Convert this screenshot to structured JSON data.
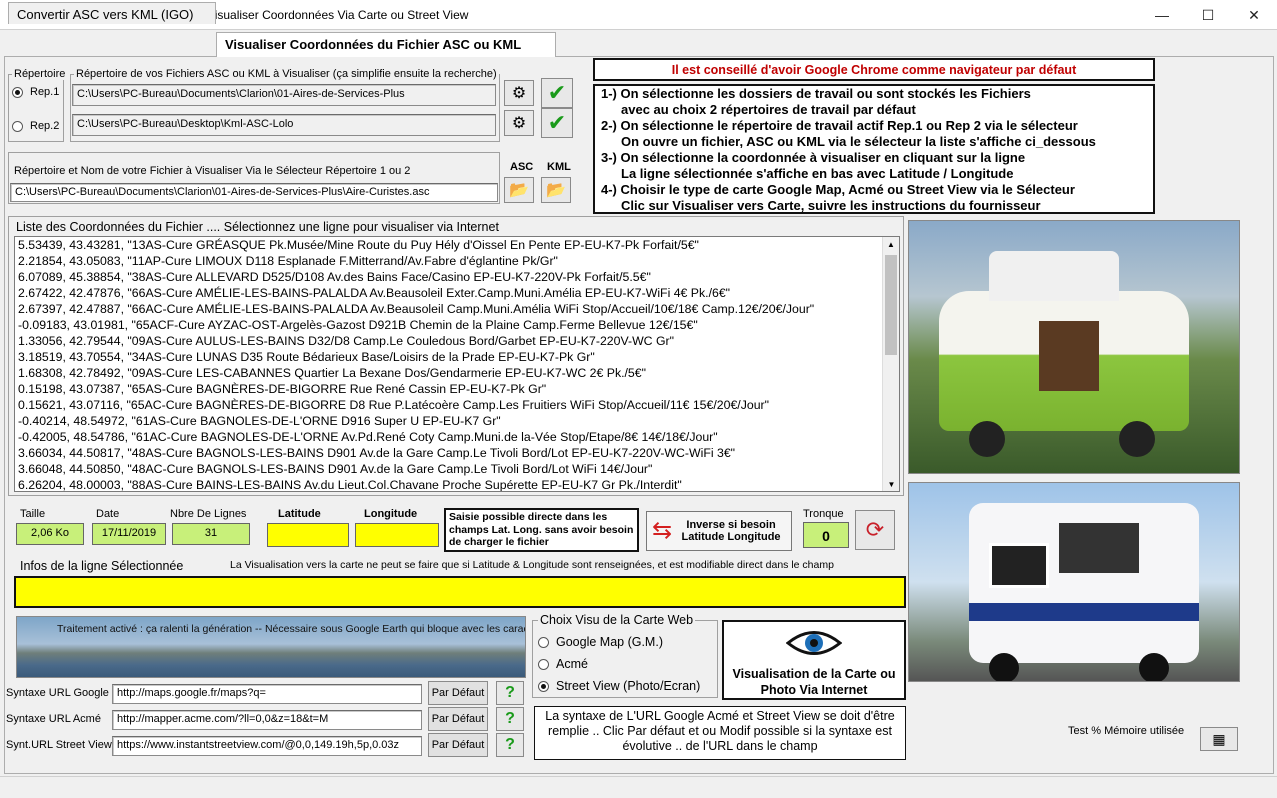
{
  "window": {
    "title": "Convertir ASC Vers KML (IGO)  -  Visualiser Coordonnées Via Carte ou Street View",
    "minimize_icon": "minimize-icon",
    "maximize_icon": "maximize-icon",
    "close_icon": "close-icon"
  },
  "tabs": [
    {
      "label": "Convertir ASC vers KML (IGO)"
    },
    {
      "label": "Visualiser Coordonnées du Fichier ASC ou KML"
    }
  ],
  "folders": {
    "repertoire_label": "Répertoire",
    "group_label": "Répertoire de vos Fichiers ASC ou KML à Visualiser (ça simplifie ensuite la recherche)",
    "rep1_label": "Rep.1",
    "rep1_path": "C:\\Users\\PC-Bureau\\Documents\\Clarion\\01-Aires-de-Services-Plus",
    "rep2_label": "Rep.2",
    "rep2_path": "C:\\Users\\PC-Bureau\\Desktop\\Kml-ASC-Lolo"
  },
  "file": {
    "group_label": "Répertoire et Nom de votre Fichier à Visualiser Via le Sélecteur Répertoire 1 ou 2",
    "path": "C:\\Users\\PC-Bureau\\Documents\\Clarion\\01-Aires-de-Services-Plus\\Aire-Curistes.asc",
    "asc_label": "ASC",
    "kml_label": "KML"
  },
  "advice": "Il est conseillé d'avoir Google Chrome comme navigateur par défaut",
  "instructions": [
    "1-) On sélectionne les dossiers de travail ou sont stockés les Fichiers",
    "avec au choix 2 répertoires de travail par défaut",
    "2-) On sélectionne le répertoire de travail actif Rep.1 ou Rep 2 via le sélecteur",
    "On ouvre un fichier, ASC ou KML via le sélecteur la liste s'affiche ci_dessous",
    "3-) On sélectionne la coordonnée à visualiser en cliquant sur la ligne",
    "La ligne sélectionnée s'affiche en bas avec Latitude / Longitude",
    "4-) Choisir le type de carte Google Map, Acmé ou Street View via le Sélecteur",
    "Clic sur Visualiser vers Carte, suivre les instructions du fournisseur"
  ],
  "list": {
    "label": "Liste des Coordonnées du Fichier  .... Sélectionnez une ligne pour visualiser via Internet",
    "rows": [
      "5.53439, 43.43281, \"13AS-Cure GRÉASQUE Pk.Musée/Mine Route du Puy Hély d'Oissel En Pente EP-EU-K7-Pk Forfait/5€\"",
      "2.21854, 43.05083, \"11AP-Cure LIMOUX D118 Esplanade F.Mitterrand/Av.Fabre d'églantine Pk/Gr\"",
      "6.07089, 45.38854, \"38AS-Cure ALLEVARD D525/D108 Av.des Bains Face/Casino EP-EU-K7-220V-Pk Forfait/5.5€\"",
      "2.67422, 42.47876, \"66AS-Cure AMÉLIE-LES-BAINS-PALALDA Av.Beausoleil Exter.Camp.Muni.Amélia EP-EU-K7-WiFi 4€ Pk./6€\"",
      "2.67397, 42.47887, \"66AC-Cure AMÉLIE-LES-BAINS-PALALDA Av.Beausoleil Camp.Muni.Amélia WiFi Stop/Accueil/10€/18€ Camp.12€/20€/Jour\"",
      "-0.09183, 43.01981, \"65ACF-Cure AYZAC-OST-Argelès-Gazost D921B Chemin de la Plaine Camp.Ferme Bellevue 12€/15€\"",
      "1.33056, 42.79544, \"09AS-Cure AULUS-LES-BAINS D32/D8 Camp.Le Couledous Bord/Garbet EP-EU-K7-220V-WC Gr\"",
      "3.18519, 43.70554, \"34AS-Cure LUNAS D35 Route Bédarieux Base/Loisirs de la Prade EP-EU-K7-Pk Gr\"",
      "1.68308, 42.78492, \"09AS-Cure LES-CABANNES Quartier La Bexane Dos/Gendarmerie EP-EU-K7-WC 2€ Pk./5€\"",
      "0.15198, 43.07387, \"65AS-Cure BAGNÈRES-DE-BIGORRE Rue René Cassin EP-EU-K7-Pk Gr\"",
      "0.15621, 43.07116, \"65AC-Cure BAGNÈRES-DE-BIGORRE D8 Rue P.Latécoère Camp.Les Fruitiers WiFi Stop/Accueil/11€ 15€/20€/Jour\"",
      "-0.40214, 48.54972, \"61AS-Cure BAGNOLES-DE-L'ORNE D916 Super U EP-EU-K7 Gr\"",
      "-0.42005, 48.54786, \"61AC-Cure BAGNOLES-DE-L'ORNE Av.Pd.René Coty Camp.Muni.de la-Vée Stop/Etape/8€ 14€/18€/Jour\"",
      "3.66034, 44.50817, \"48AS-Cure BAGNOLS-LES-BAINS D901 Av.de la Gare Camp.Le Tivoli Bord/Lot EP-EU-K7-220V-WC-WiFi 3€\"",
      "3.66048, 44.50850, \"48AC-Cure BAGNOLS-LES-BAINS D901 Av.de la Gare Camp.Le Tivoli Bord/Lot WiFi 14€/Jour\"",
      "6.26204, 48.00003, \"88AS-Cure BAINS-LES-BAINS Av.du Lieut.Col.Chavane Proche Supérette EP-EU-K7 Gr Pk./Interdit\""
    ]
  },
  "stats": {
    "taille_label": "Taille",
    "taille": "2,06 Ko",
    "date_label": "Date",
    "date": "17/11/2019",
    "lignes_label": "Nbre De Lignes",
    "lignes": "31",
    "latitude_label": "Latitude",
    "latitude": "",
    "longitude_label": "Longitude",
    "longitude": "",
    "saisie_note": "Saisie possible directe dans les champs Lat. Long. sans avoir besoin de charger le fichier",
    "inverse_label": "Inverse si besoin Latitude Longitude",
    "tronque_label": "Tronque",
    "tronque": "0"
  },
  "info": {
    "label": "Infos de la ligne Sélectionnée",
    "note": "La Visualisation vers la carte ne peut se faire que si Latitude & Longitude sont renseignées, et est modifiable direct dans le champ",
    "value": ""
  },
  "banner": "Traitement activé : ça ralenti la génération -- Nécessaire sous Google Earth qui bloque avec les caractères spéciaux",
  "urls": {
    "google_label": "Syntaxe URL Google",
    "google": "http://maps.google.fr/maps?q=",
    "acme_label": "Syntaxe URL Acmé",
    "acme": "http://mapper.acme.com/?ll=0,0&z=18&t=M",
    "street_label": "Synt.URL Street View",
    "street": "https://www.instantstreetview.com/@0,0,149.19h,5p,0.03z",
    "default_label": "Par Défaut",
    "help_label": "?"
  },
  "map_choice": {
    "label": "Choix Visu de la Carte Web",
    "options": [
      "Google Map  (G.M.)",
      "Acmé",
      "Street View (Photo/Ecran)"
    ],
    "selected": 2
  },
  "visualise_label": "Visualisation de la Carte ou Photo Via Internet",
  "syntax_note": "La syntaxe de L'URL Google Acmé et Street View se doit d'être remplie .. Clic Par défaut et ou Modif possible si la syntaxe est évolutive ..  de l'URL dans le champ",
  "memory_label": "Test % Mémoire utilisée"
}
